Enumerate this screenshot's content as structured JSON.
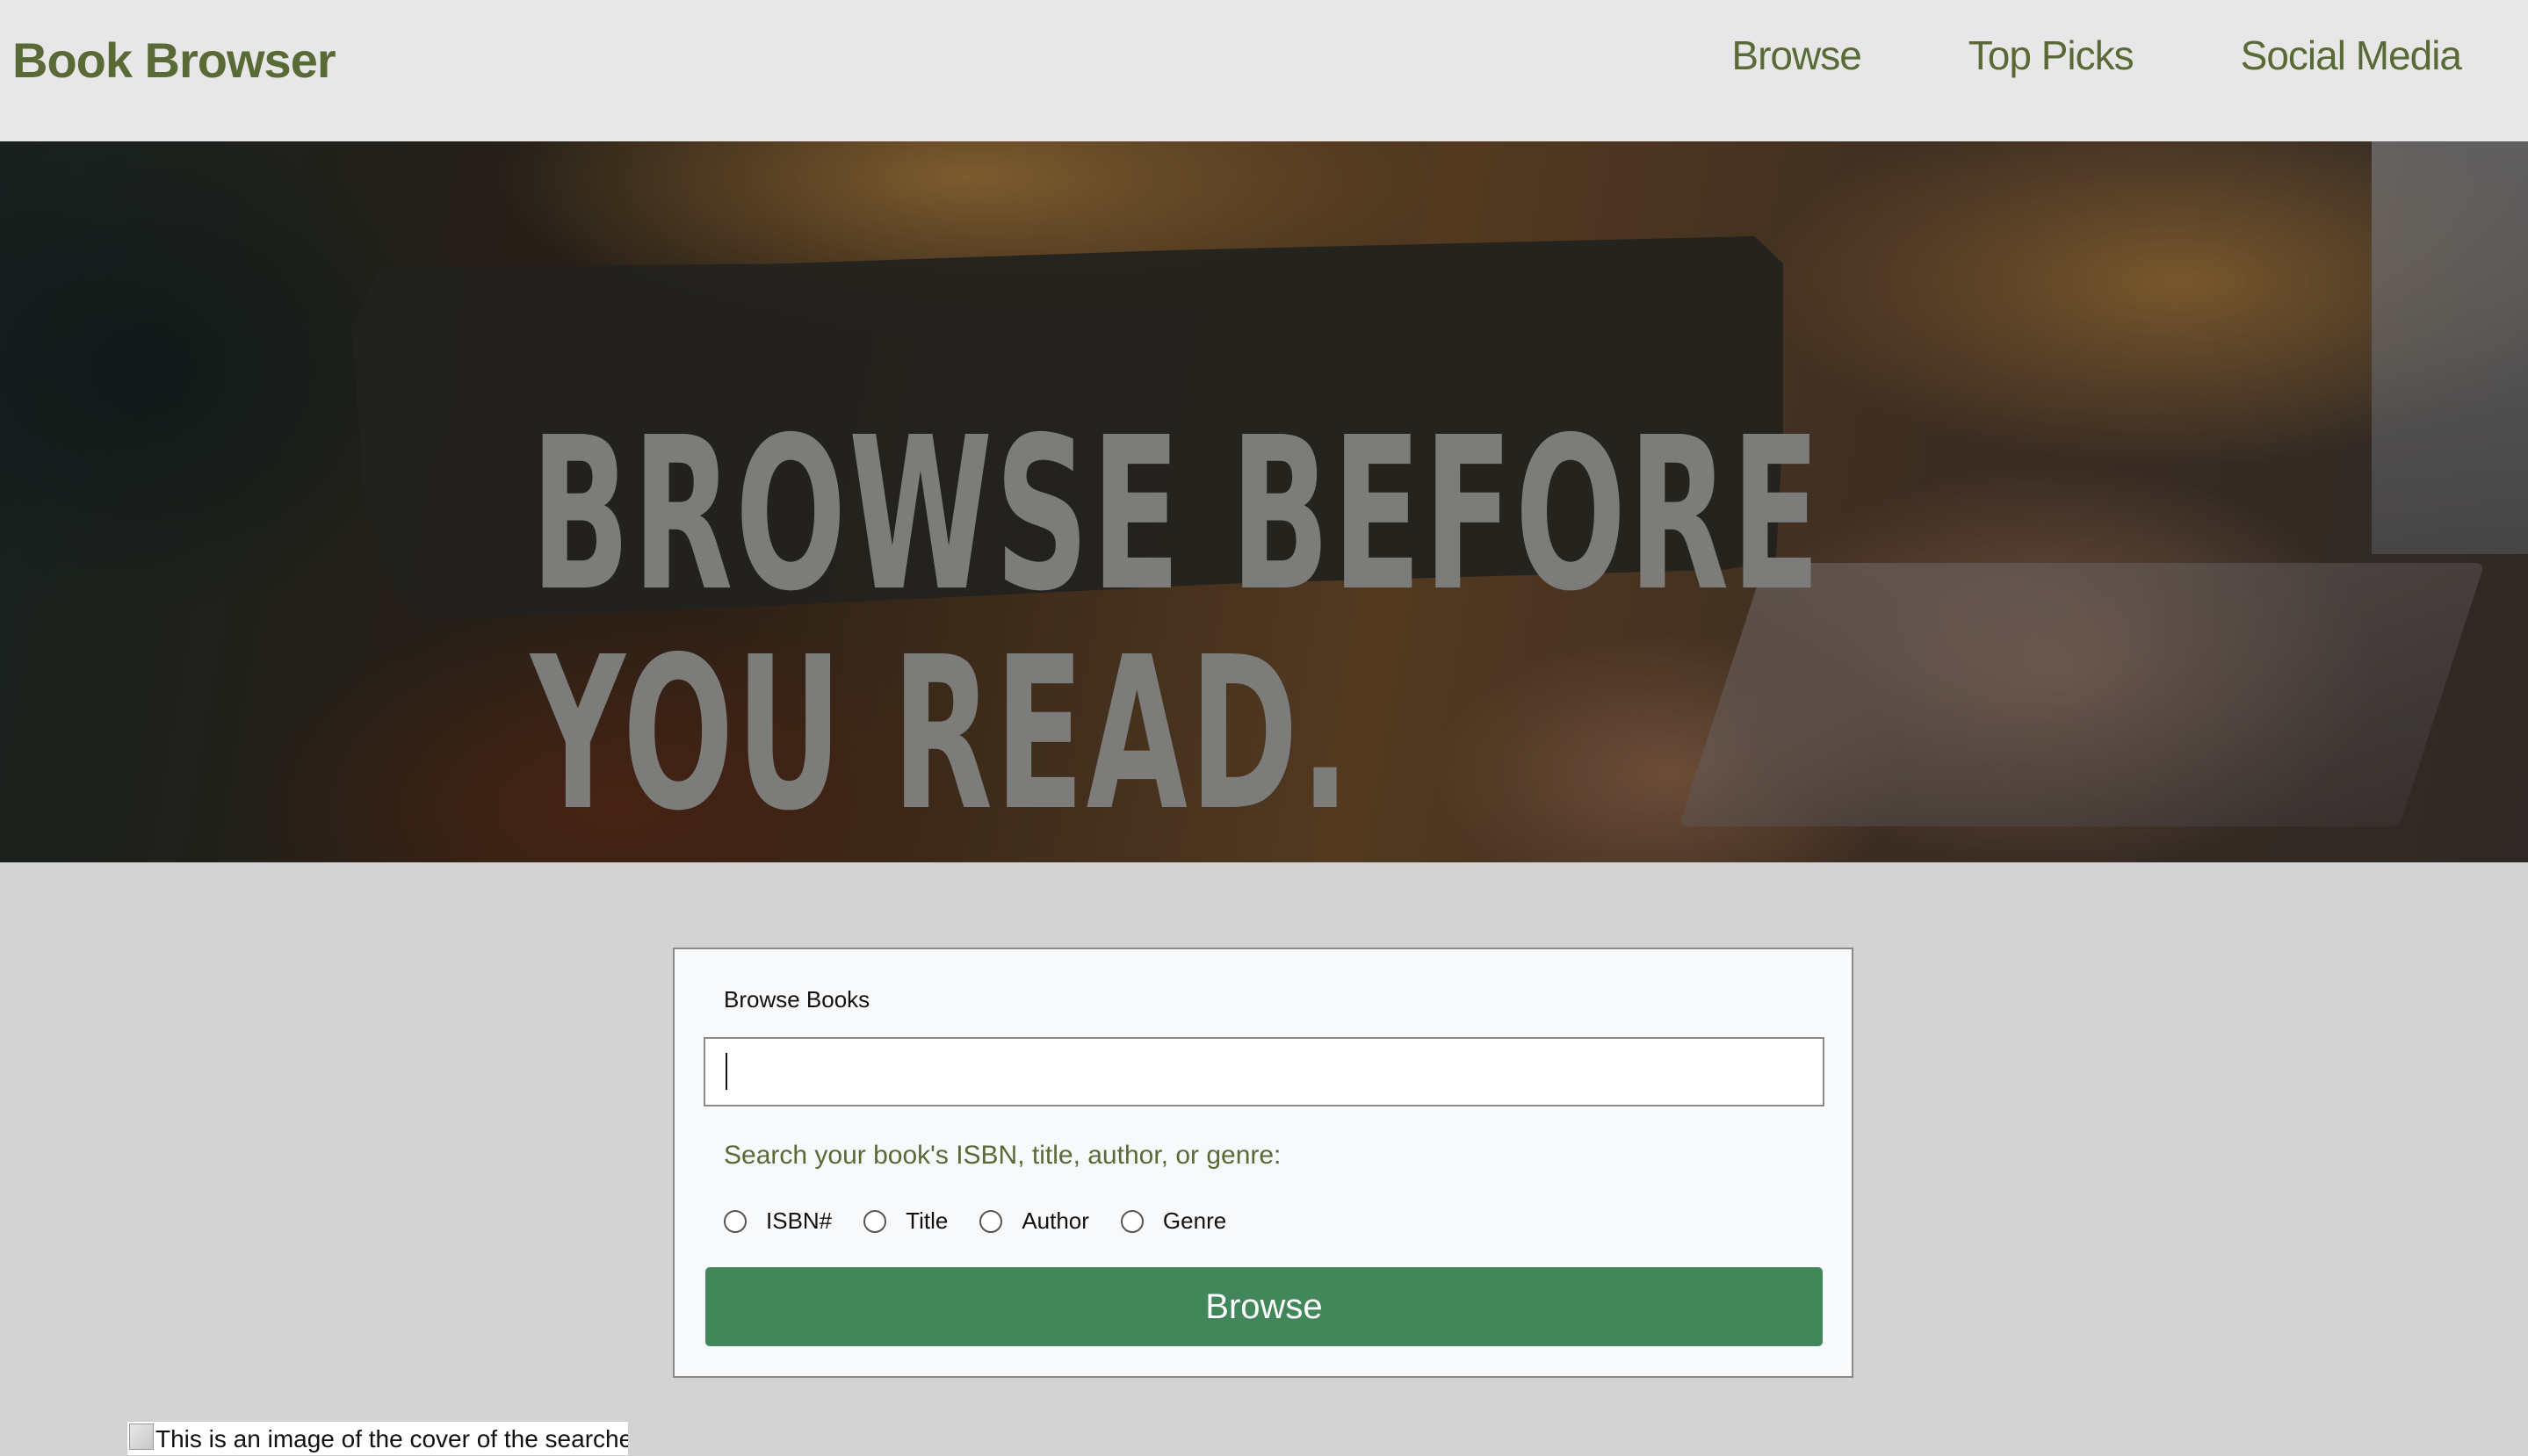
{
  "header": {
    "brand": "Book Browser",
    "nav": {
      "browse": "Browse",
      "top_picks": "Top Picks",
      "social_media": "Social Media"
    }
  },
  "hero": {
    "title": "BROWSE BEFORE\nYOU READ."
  },
  "search_card": {
    "title": "Browse Books",
    "input_value": "",
    "hint": "Search your book's ISBN, title, author, or genre:",
    "options": {
      "isbn": "ISBN#",
      "title": "Title",
      "author": "Author",
      "genre": "Genre"
    },
    "selected_option": "",
    "button_label": "Browse"
  },
  "result": {
    "image_alt": "This is an image of the cover of the searched"
  },
  "colors": {
    "brand_green": "#5a6a37",
    "button_green": "#41875a",
    "header_bg": "#e7e7e7",
    "page_bg": "#d3d3d3"
  }
}
